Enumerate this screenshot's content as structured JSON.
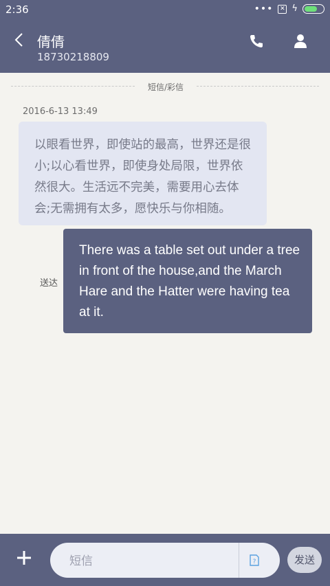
{
  "status_bar": {
    "time": "2:36",
    "dots": "•••",
    "sim_glyph": "✕",
    "charging_glyph": "ϟ",
    "battery_level": 0.7,
    "battery_color": "#6ee07a"
  },
  "header": {
    "contact_name": "倩倩",
    "contact_number": "18730218809",
    "background": "#5b6180"
  },
  "conversation": {
    "divider_label": "短信/彩信",
    "timestamp": "2016-6-13 13:49",
    "incoming_message": "以眼看世界，即使站的最高，世界还是很小;以心看世界，即使身处局限，世界依然很大。生活远不完美，需要用心去体会;无需拥有太多，愿快乐与你相随。",
    "sent_status": "送达",
    "outgoing_message": "There was a table set out under a tree in front of the house,and the March Hare and the Hatter were having tea at it."
  },
  "composer": {
    "placeholder": "短信",
    "send_label": "发送",
    "sim_label": "?"
  }
}
